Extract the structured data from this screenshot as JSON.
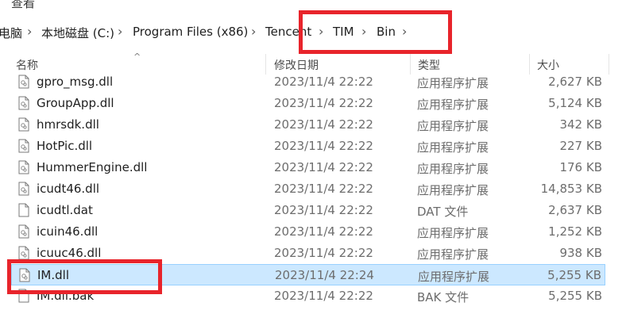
{
  "menu": {
    "view_label": "查看"
  },
  "breadcrumb": {
    "items": [
      "电脑",
      "本地磁盘 (C:)",
      "Program Files (x86)",
      "Tencent",
      "TIM",
      "Bin"
    ]
  },
  "columns": {
    "name": "名称",
    "date": "修改日期",
    "type": "类型",
    "size": "大小"
  },
  "files": [
    {
      "name": "gpro_msg.dll",
      "date": "2023/11/4 22:22",
      "type": "应用程序扩展",
      "size": "2,627 KB",
      "icon": "dll-icon"
    },
    {
      "name": "GroupApp.dll",
      "date": "2023/11/4 22:22",
      "type": "应用程序扩展",
      "size": "5,124 KB",
      "icon": "dll-icon"
    },
    {
      "name": "hmrsdk.dll",
      "date": "2023/11/4 22:22",
      "type": "应用程序扩展",
      "size": "342 KB",
      "icon": "dll-icon"
    },
    {
      "name": "HotPic.dll",
      "date": "2023/11/4 22:22",
      "type": "应用程序扩展",
      "size": "227 KB",
      "icon": "dll-icon"
    },
    {
      "name": "HummerEngine.dll",
      "date": "2023/11/4 22:22",
      "type": "应用程序扩展",
      "size": "176 KB",
      "icon": "dll-icon"
    },
    {
      "name": "icudt46.dll",
      "date": "2023/11/4 22:22",
      "type": "应用程序扩展",
      "size": "14,853 KB",
      "icon": "dll-icon"
    },
    {
      "name": "icudtl.dat",
      "date": "2023/11/4 22:22",
      "type": "DAT 文件",
      "size": "2,637 KB",
      "icon": "file-icon"
    },
    {
      "name": "icuin46.dll",
      "date": "2023/11/4 22:22",
      "type": "应用程序扩展",
      "size": "1,252 KB",
      "icon": "dll-icon"
    },
    {
      "name": "icuuc46.dll",
      "date": "2023/11/4 22:22",
      "type": "应用程序扩展",
      "size": "938 KB",
      "icon": "dll-icon"
    },
    {
      "name": "IM.dll",
      "date": "2023/11/4 22:24",
      "type": "应用程序扩展",
      "size": "5,255 KB",
      "icon": "dll-icon",
      "selected": true
    },
    {
      "name": "IM.dll.bak",
      "date": "2023/11/4 22:22",
      "type": "BAK 文件",
      "size": "5,255 KB",
      "icon": "file-icon"
    }
  ],
  "colors": {
    "selection_bg": "#cce8ff",
    "selection_border": "#99d1ff",
    "annotation_red": "#e8242b"
  }
}
